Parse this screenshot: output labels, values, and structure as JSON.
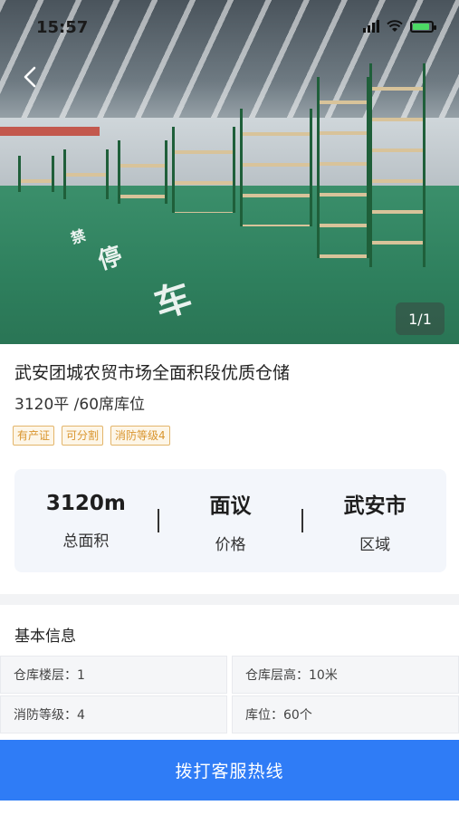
{
  "status_bar": {
    "time": "15:57"
  },
  "gallery": {
    "indicator": "1/1"
  },
  "listing": {
    "title": "武安团城农贸市场全面积段优质仓储",
    "subtitle": "3120平 /60席库位",
    "tags": [
      "有产证",
      "可分割",
      "消防等级4"
    ]
  },
  "stats": [
    {
      "value": "3120m",
      "label": "总面积"
    },
    {
      "value": "面议",
      "label": "价格"
    },
    {
      "value": "武安市",
      "label": "区域"
    }
  ],
  "basic_info": {
    "title": "基本信息",
    "items": [
      "仓库楼层：1",
      "仓库层高：10米",
      "消防等级：4",
      "库位：60个"
    ]
  },
  "actions": {
    "call_label": "拨打客服热线"
  },
  "colors": {
    "primary": "#2f7cf6",
    "tag_border": "#e3b56a",
    "tag_text": "#d9952e"
  }
}
